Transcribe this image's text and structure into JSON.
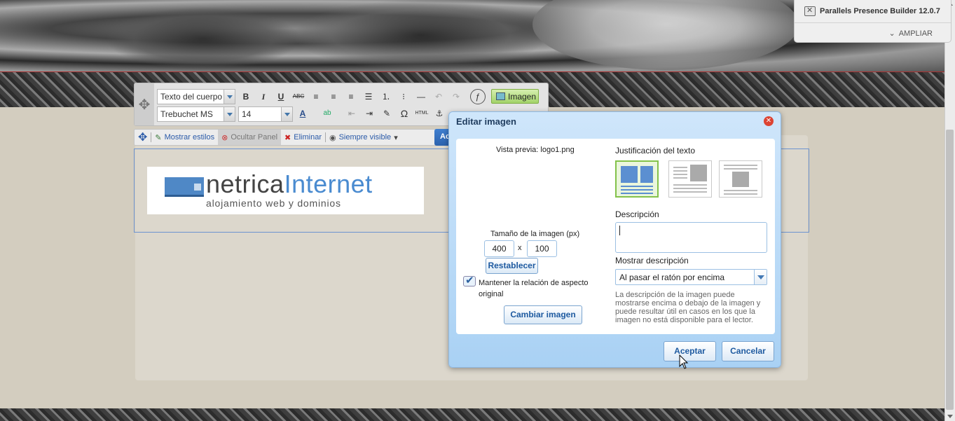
{
  "presence": {
    "title": "Parallels Presence Builder 12.0.7",
    "expand_label": "AMPLIAR"
  },
  "toolbar": {
    "style_select": "Texto del cuerpo",
    "font_select": "Trebuchet MS",
    "size_select": "14",
    "image_button": "Imagen",
    "buttons": {
      "bold": "B",
      "italic": "I",
      "underline": "U",
      "strike": "ABC",
      "omega": "Ω",
      "html": "HTML"
    }
  },
  "toolbar2": {
    "show_styles": "Mostrar estilos",
    "hide_panel": "Ocultar Panel",
    "delete": "Eliminar",
    "always_visible": "Siempre visible",
    "partial_button": "Ac"
  },
  "logo": {
    "name_dark": "netrica",
    "name_blue": "Internet",
    "tagline": "alojamiento web y dominios"
  },
  "dialog": {
    "title": "Editar imagen",
    "preview_label": "Vista previa: logo1.png",
    "size_label": "Tamaño de la imagen (px)",
    "width": "400",
    "height": "100",
    "size_separator": "x",
    "reset_button": "Restablecer",
    "keep_aspect_label": "Mantener la relación de aspecto original",
    "change_image_button": "Cambiar imagen",
    "justification_label": "Justificación del texto",
    "description_label": "Descripción",
    "show_description_label": "Mostrar descripción",
    "show_description_value": "Al pasar el ratón por encima",
    "help_text": "La descripción de la imagen puede mostrarse encima o debajo de la imagen y puede resultar útil en casos en los que la imagen no está disponible para el lector.",
    "ok_button": "Aceptar",
    "cancel_button": "Cancelar"
  },
  "colors": {
    "dialog_bg": "#bfdcf7",
    "accent_blue": "#1e5aa0",
    "selected_green": "#83c24a",
    "image_button_green": "#a3d36a"
  }
}
